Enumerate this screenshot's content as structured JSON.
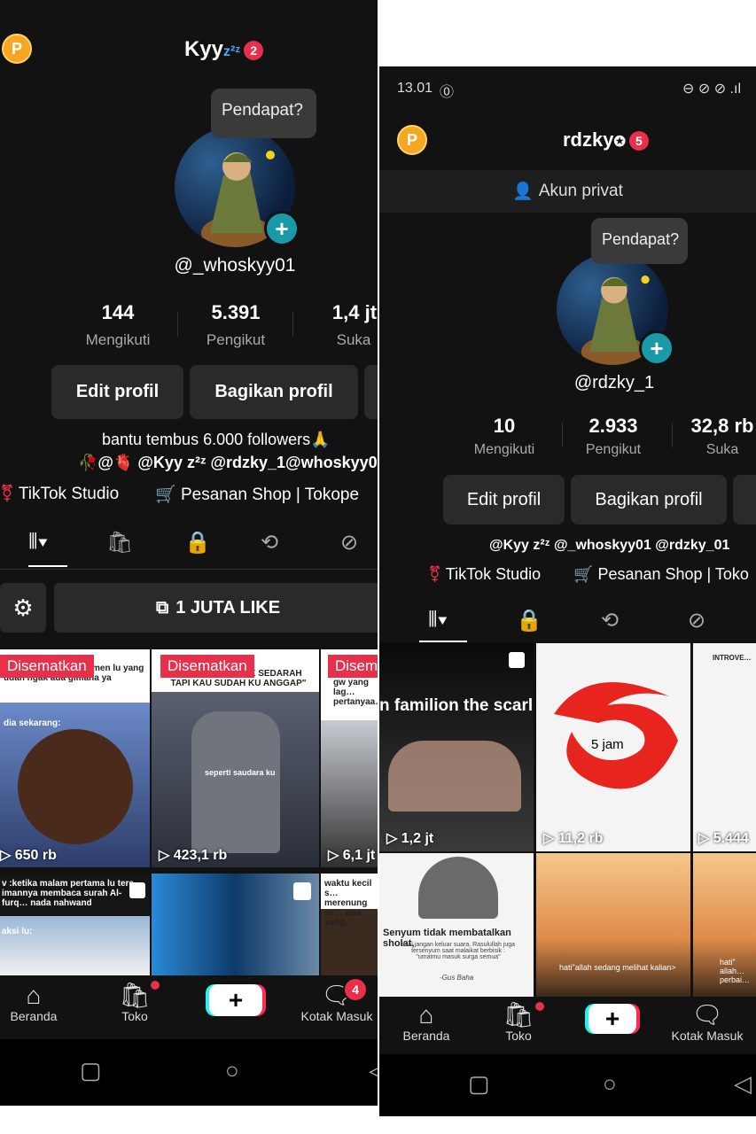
{
  "left": {
    "username": "Kyy",
    "username_suffix": "z²ᶻ",
    "notif_count": "2",
    "coin_label": "P",
    "tooltip": "Pendapat?",
    "handle": "@_whoskyy01",
    "stats": [
      {
        "value": "144",
        "label": "Mengikuti"
      },
      {
        "value": "5.391",
        "label": "Pengikut"
      },
      {
        "value": "1,4 jt",
        "label": "Suka"
      }
    ],
    "edit_button": "Edit profil",
    "share_button": "Bagikan profil",
    "bio_line1": "bantu tembus 6.000  followers🙏",
    "bio_line2": "🥀@🫀 @Kyy z²ᶻ @rdzky_1@whoskyy0",
    "studio_link": "TikTok Studio",
    "shop_link": "Pesanan Shop | Tokope",
    "collection_label": "1 JUTA LIKE",
    "pinned_label": "Disematkan",
    "pinned_label_short": "Disem",
    "videos": [
      {
        "views": "650 rb",
        "caption": "…ba-tiba ke rum… temen lu yang udah ngak ada gimana ya",
        "caption2": "dia sekarang:"
      },
      {
        "views": "423,1 rb",
        "caption": "WALAUPUN TIDAK SEDARAH TAPI KAU SUDAH KU ANGGAP\"",
        "caption2": "seperti saudara ku"
      },
      {
        "views": "6,1 jt",
        "caption": "gw yang lag… pertanyaa…",
        "caption2": ""
      },
      {
        "views": "",
        "caption": "v :ketika malam pertama lu tere… imannya membaca surah Al-furq… nada nahwand",
        "caption2": "aksi lu:"
      },
      {
        "views": "",
        "caption": "",
        "caption2": ""
      },
      {
        "views": "",
        "caption": "waktu kecil s… merenung se… apa yang…",
        "caption2": ""
      }
    ],
    "nav": {
      "home": "Beranda",
      "shop": "Toko",
      "inbox": "Kotak Masuk",
      "inbox_count": "4"
    }
  },
  "right": {
    "time": "13.01",
    "username": "rdzky",
    "notif_count": "5",
    "coin_label": "P",
    "private_label": "Akun privat",
    "tooltip": "Pendapat?",
    "handle": "@rdzky_1",
    "stats": [
      {
        "value": "10",
        "label": "Mengikuti"
      },
      {
        "value": "2.933",
        "label": "Pengikut"
      },
      {
        "value": "32,8 rb",
        "label": "Suka"
      }
    ],
    "edit_button": "Edit profil",
    "share_button": "Bagikan profil",
    "bio_line1": "@Kyy z²ᶻ @_whoskyy01 @rdzky_01",
    "studio_link": "TikTok Studio",
    "shop_link": "Pesanan Shop | Toko",
    "videos": [
      {
        "views": "1,2 jt",
        "caption": "n familion the scarl"
      },
      {
        "views": "11,2 rb",
        "caption": "5 jam"
      },
      {
        "views": "5.444",
        "caption": "INTROVE…"
      },
      {
        "views": "",
        "caption": "Senyum tidak membatalkan sholat,",
        "caption2": "asal jangan keluar suara. Rasulullah juga tersenyum saat malaikat berbisik : \"umatmu masuk surga semua\"",
        "caption3": "-Gus Baha"
      },
      {
        "views": "",
        "caption": "hati\"allah sedang melihat kalian>"
      },
      {
        "views": "",
        "caption": "hati\" allah… perbai…"
      }
    ],
    "nav": {
      "home": "Beranda",
      "shop": "Toko",
      "inbox": "Kotak Masuk"
    }
  },
  "colors": {
    "accent_red": "#e8304a",
    "teal": "#1a9aa8",
    "coin": "#f5a623",
    "background": "#121212"
  }
}
